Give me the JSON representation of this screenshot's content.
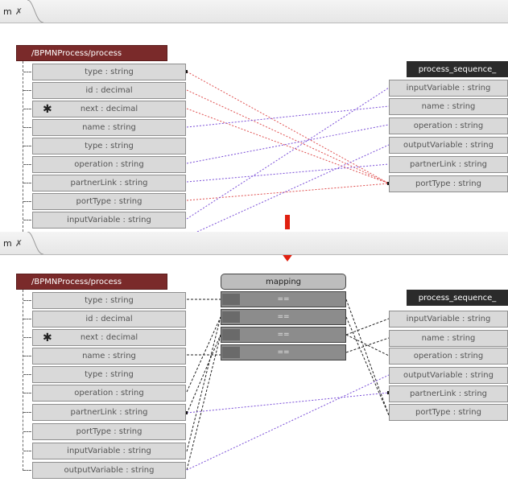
{
  "top_tab": {
    "label": "m",
    "close": "✗"
  },
  "bottom_tab": {
    "label": "m",
    "close": "✗"
  },
  "top": {
    "source_title": "/BPMNProcess/process",
    "source_fields": [
      "type : string",
      "id : decimal",
      "next : decimal",
      "name : string",
      "type : string",
      "operation : string",
      "partnerLink : string",
      "portType : string",
      "inputVariable : string"
    ],
    "target_title": "process_sequence_",
    "target_fields": [
      "inputVariable : string",
      "name : string",
      "operation : string",
      "outputVariable : string",
      "partnerLink : string",
      "portType : string"
    ]
  },
  "bottom": {
    "source_title": "/BPMNProcess/process",
    "source_fields": [
      "type : string",
      "id : decimal",
      "next : decimal",
      "name : string",
      "type : string",
      "operation : string",
      "partnerLink : string",
      "portType : string",
      "inputVariable : string",
      "outputVariable : string"
    ],
    "mapping_title": "mapping",
    "mapping_rows": [
      "==",
      "==",
      "==",
      "=="
    ],
    "target_title": "process_sequence_",
    "target_fields": [
      "inputVariable : string",
      "name : string",
      "operation : string",
      "outputVariable : string",
      "partnerLink : string",
      "portType : string"
    ]
  },
  "marker": "✱",
  "colors": {
    "source_header": "#7a2a2a",
    "target_header": "#2b2b2b",
    "purple_link": "#7b4fd8",
    "red_link": "#e05050",
    "arrow": "#e02010"
  }
}
